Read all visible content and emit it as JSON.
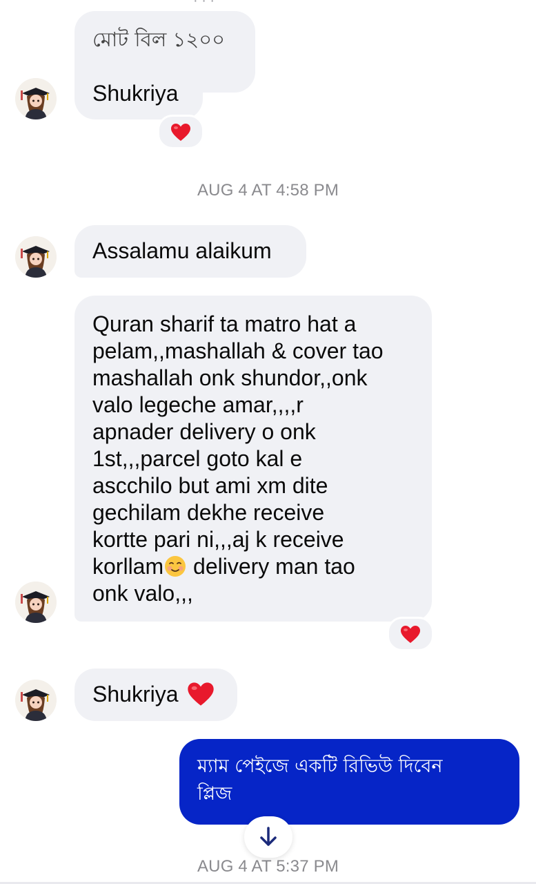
{
  "messages": {
    "bill_text": "মোট বিল ১২০০",
    "shukriya_1": "Shukriya",
    "assalamu": "Assalamu alaikum",
    "long_lines": [
      "Quran sharif ta matro hat a",
      "pelam,,mashallah & cover tao",
      "mashallah onk shundor,,onk",
      "valo legeche amar,,,,r",
      "apnader delivery o onk",
      "1st,,,parcel goto kal e",
      "ascchilo but ami xm dite",
      "gechilam dekhe receive",
      "kortte pari ni,,,aj k receive",
      "korllam",
      " delivery man tao",
      "onk valo,,,"
    ],
    "shukriya_2": "Shukriya",
    "outgoing_lines": [
      "ম্যাম পেইজে একটি রিভিউ দিবেন",
      "প্লিজ"
    ]
  },
  "timestamps": {
    "first": "AUG 4 AT 4:58 PM",
    "second": "AUG 4 AT 5:37 PM"
  },
  "icons": {
    "reaction": "heart-emoji",
    "smile": "smiling-face-emoji",
    "scroll": "arrow-down-icon"
  },
  "colors": {
    "incoming_bubble": "#f0f1f5",
    "outgoing_bubble": "#0625c7",
    "heart": "#e8192c",
    "timestamp": "#8a8a8e"
  }
}
